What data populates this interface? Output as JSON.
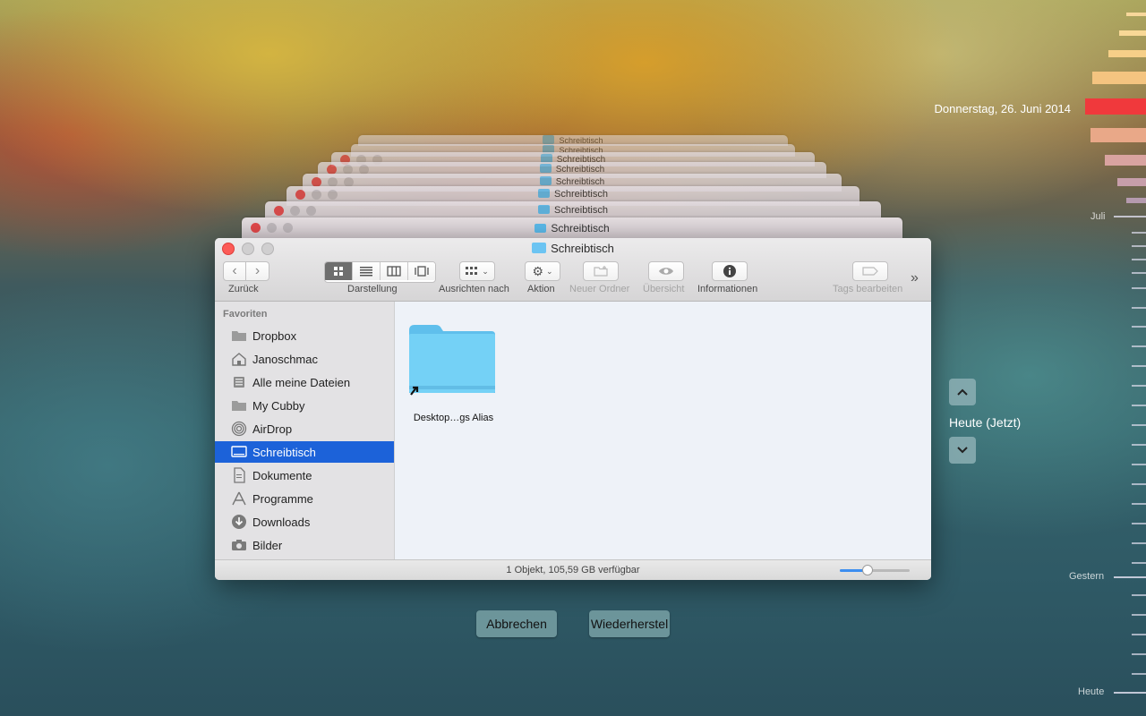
{
  "background_windows": {
    "title": "Schreibtisch"
  },
  "window": {
    "title": "Schreibtisch"
  },
  "toolbar": {
    "back_label": "Zurück",
    "view_label": "Darstellung",
    "arrange_label": "Ausrichten nach",
    "action_label": "Aktion",
    "new_folder_label": "Neuer Ordner",
    "quicklook_label": "Übersicht",
    "info_label": "Informationen",
    "tags_label": "Tags bearbeiten",
    "overflow": "»"
  },
  "sidebar": {
    "heading": "Favoriten",
    "items": [
      {
        "label": "Dropbox",
        "icon": "folder-icon"
      },
      {
        "label": "Janoschmac",
        "icon": "home-icon"
      },
      {
        "label": "Alle meine Dateien",
        "icon": "all-files-icon"
      },
      {
        "label": "My Cubby",
        "icon": "folder-icon"
      },
      {
        "label": "AirDrop",
        "icon": "airdrop-icon"
      },
      {
        "label": "Schreibtisch",
        "icon": "desktop-icon",
        "selected": true
      },
      {
        "label": "Dokumente",
        "icon": "documents-icon"
      },
      {
        "label": "Programme",
        "icon": "applications-icon"
      },
      {
        "label": "Downloads",
        "icon": "downloads-icon"
      },
      {
        "label": "Bilder",
        "icon": "camera-icon"
      }
    ]
  },
  "content": {
    "items": [
      {
        "label": "Desktop…gs Alias",
        "icon": "alias-folder-icon"
      }
    ]
  },
  "status": {
    "text": "1 Objekt, 105,59 GB verfügbar",
    "zoom_level": 0.4
  },
  "buttons": {
    "cancel": "Abbrechen",
    "restore": "Wiederherstel"
  },
  "timemachine": {
    "date": "Donnerstag, 26. Juni 2014",
    "current": "Heute (Jetzt)",
    "timeline": {
      "juli": "Juli",
      "gestern": "Gestern",
      "heute": "Heute"
    }
  },
  "colors": {
    "accent": "#1c62d9",
    "timeline_selected": "#f0393c"
  }
}
